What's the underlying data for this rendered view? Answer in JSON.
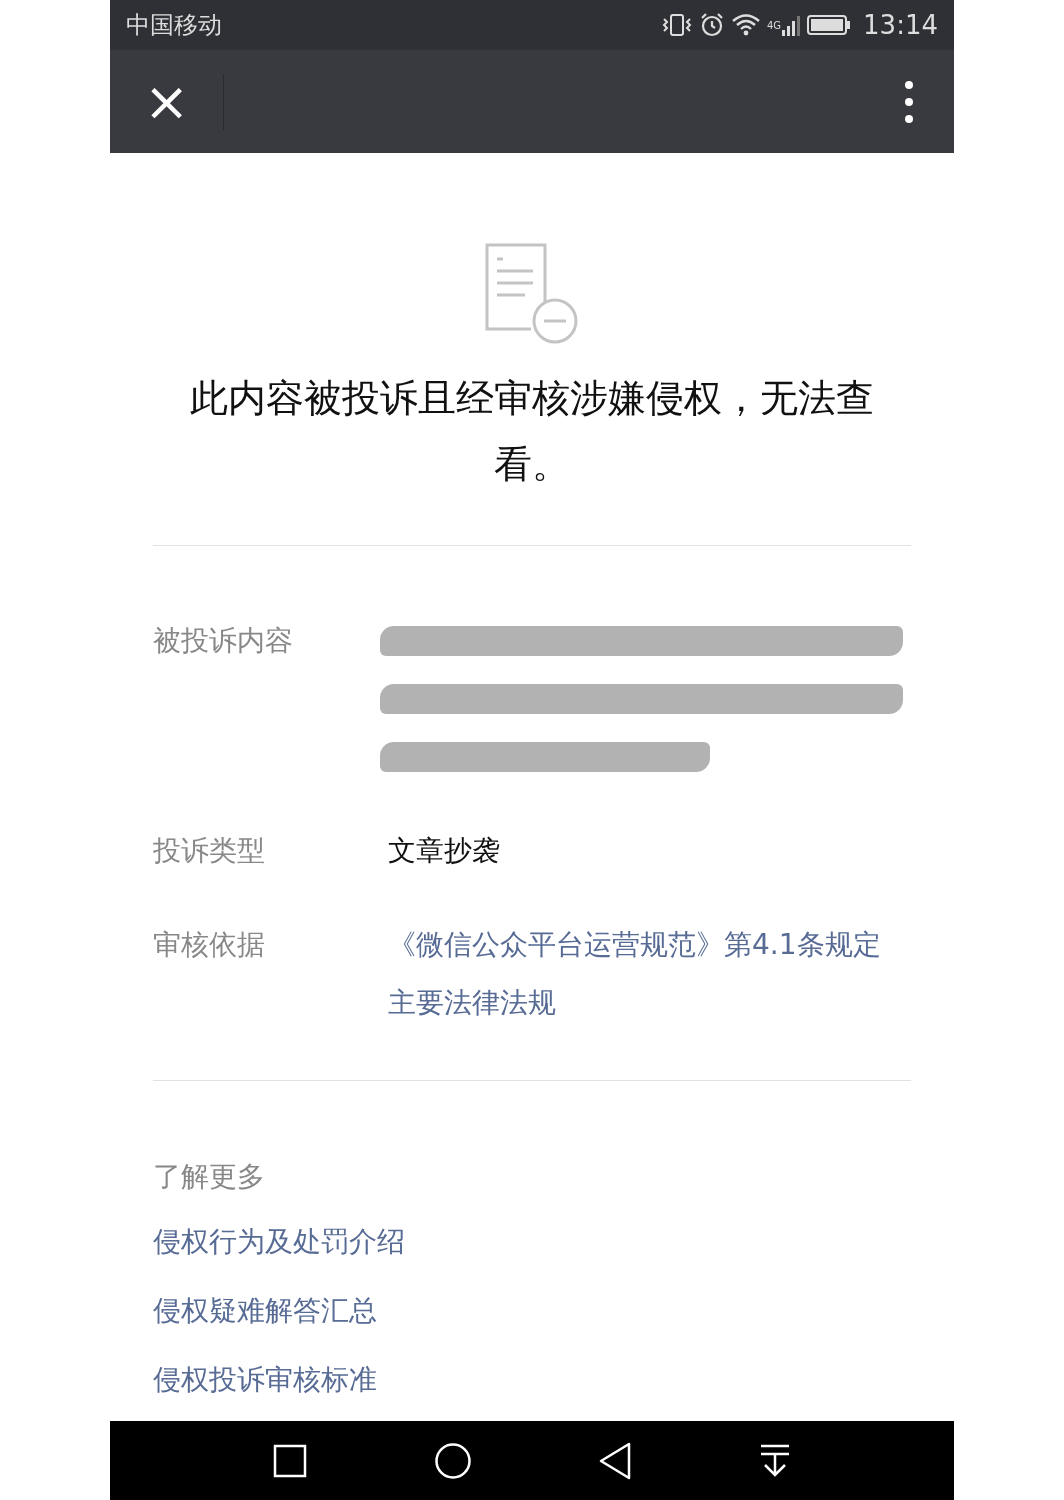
{
  "status_bar": {
    "carrier": "中国移动",
    "time": "13:14",
    "network": "4G"
  },
  "header": {
    "close_icon": "×"
  },
  "notice": {
    "title": "此内容被投诉且经审核涉嫌侵权，无法查看。"
  },
  "details": [
    {
      "label": "被投诉内容",
      "kind": "redacted",
      "lines": [
        {
          "kind": "full"
        },
        {
          "kind": "full"
        },
        {
          "kind": "partial"
        }
      ]
    },
    {
      "label": "投诉类型",
      "kind": "text",
      "value": "文章抄袭"
    },
    {
      "label": "审核依据",
      "kind": "links",
      "links": [
        "《微信公众平台运营规范》第4.1条规定",
        "主要法律法规"
      ]
    }
  ],
  "learn_more": {
    "title": "了解更多",
    "links": [
      "侵权行为及处罚介绍",
      "侵权疑难解答汇总",
      "侵权投诉审核标准"
    ]
  }
}
